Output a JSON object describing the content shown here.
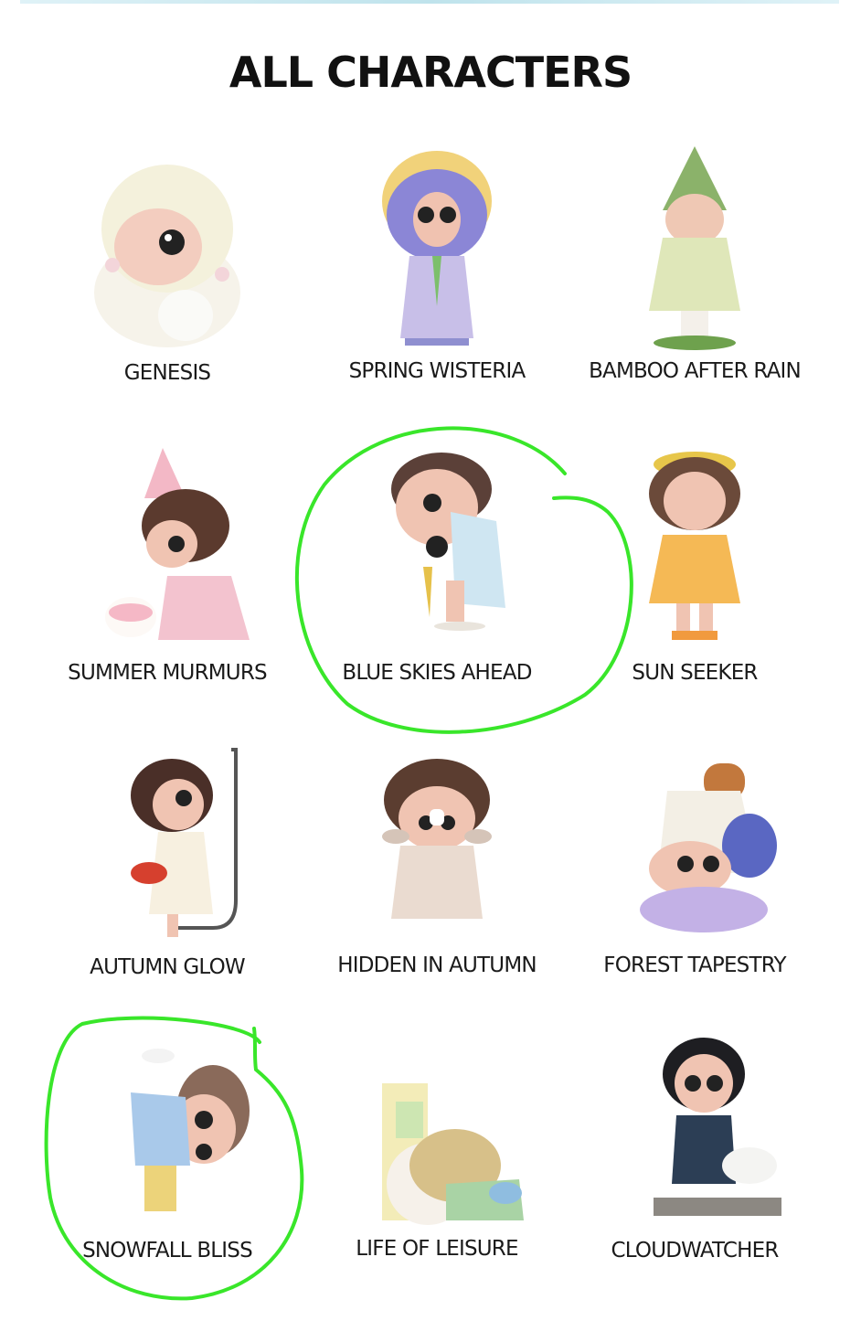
{
  "page": {
    "title": "ALL CHARACTERS"
  },
  "characters": [
    {
      "name": "GENESIS",
      "icon": "genesis-figure-icon",
      "circled": false
    },
    {
      "name": "SPRING WISTERIA",
      "icon": "spring-wisteria-figure-icon",
      "circled": false
    },
    {
      "name": "BAMBOO AFTER RAIN",
      "icon": "bamboo-after-rain-figure-icon",
      "circled": false
    },
    {
      "name": "SUMMER MURMURS",
      "icon": "summer-murmurs-figure-icon",
      "circled": false
    },
    {
      "name": "BLUE SKIES AHEAD",
      "icon": "blue-skies-ahead-figure-icon",
      "circled": true
    },
    {
      "name": "SUN SEEKER",
      "icon": "sun-seeker-figure-icon",
      "circled": false
    },
    {
      "name": "AUTUMN GLOW",
      "icon": "autumn-glow-figure-icon",
      "circled": false
    },
    {
      "name": "HIDDEN IN AUTUMN",
      "icon": "hidden-in-autumn-figure-icon",
      "circled": false
    },
    {
      "name": "FOREST TAPESTRY",
      "icon": "forest-tapestry-figure-icon",
      "circled": false
    },
    {
      "name": "SNOWFALL BLISS",
      "icon": "snowfall-bliss-figure-icon",
      "circled": true
    },
    {
      "name": "LIFE OF LEISURE",
      "icon": "life-of-leisure-figure-icon",
      "circled": false
    },
    {
      "name": "CLOUDWATCHER",
      "icon": "cloudwatcher-figure-icon",
      "circled": false
    }
  ],
  "colors": {
    "annotation": "#39e62a",
    "text": "#1a1a1a"
  }
}
